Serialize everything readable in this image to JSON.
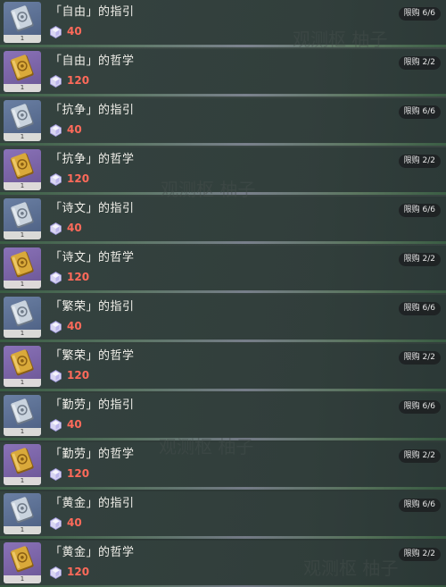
{
  "items": [
    {
      "name": "「自由」的指引",
      "price": "40",
      "limit": "限购 6/6",
      "tier": "silver",
      "level": "1",
      "icon": "freedom-guide-book-icon"
    },
    {
      "name": "「自由」的哲学",
      "price": "120",
      "limit": "限购 2/2",
      "tier": "gold",
      "level": "1",
      "icon": "freedom-philosophy-book-icon"
    },
    {
      "name": "「抗争」的指引",
      "price": "40",
      "limit": "限购 6/6",
      "tier": "silver",
      "level": "1",
      "icon": "resistance-guide-book-icon"
    },
    {
      "name": "「抗争」的哲学",
      "price": "120",
      "limit": "限购 2/2",
      "tier": "gold",
      "level": "1",
      "icon": "resistance-philosophy-book-icon"
    },
    {
      "name": "「诗文」的指引",
      "price": "40",
      "limit": "限购 6/6",
      "tier": "silver",
      "level": "1",
      "icon": "ballad-guide-book-icon"
    },
    {
      "name": "「诗文」的哲学",
      "price": "120",
      "limit": "限购 2/2",
      "tier": "gold",
      "level": "1",
      "icon": "ballad-philosophy-book-icon"
    },
    {
      "name": "「繁荣」的指引",
      "price": "40",
      "limit": "限购 6/6",
      "tier": "silver",
      "level": "1",
      "icon": "prosperity-guide-book-icon"
    },
    {
      "name": "「繁荣」的哲学",
      "price": "120",
      "limit": "限购 2/2",
      "tier": "gold",
      "level": "1",
      "icon": "prosperity-philosophy-book-icon"
    },
    {
      "name": "「勤劳」的指引",
      "price": "40",
      "limit": "限购 6/6",
      "tier": "silver",
      "level": "1",
      "icon": "diligence-guide-book-icon"
    },
    {
      "name": "「勤劳」的哲学",
      "price": "120",
      "limit": "限购 2/2",
      "tier": "gold",
      "level": "1",
      "icon": "diligence-philosophy-book-icon"
    },
    {
      "name": "「黄金」的指引",
      "price": "40",
      "limit": "限购 6/6",
      "tier": "silver",
      "level": "1",
      "icon": "gold-guide-book-icon"
    },
    {
      "name": "「黄金」的哲学",
      "price": "120",
      "limit": "限购 2/2",
      "tier": "gold",
      "level": "1",
      "icon": "gold-philosophy-book-icon"
    }
  ],
  "currency_icon": "crystal-currency-icon",
  "colors": {
    "price": "#ff6a5a",
    "rarity_blue": "#5a6e92",
    "rarity_purple": "#7a64a8",
    "silver_book": "#c9d3de",
    "gold_book": "#d9a93a"
  },
  "watermark": [
    "观测枢 柚子",
    "观测枢 柚子",
    "观测枢 柚子",
    "观测枢 柚子"
  ]
}
